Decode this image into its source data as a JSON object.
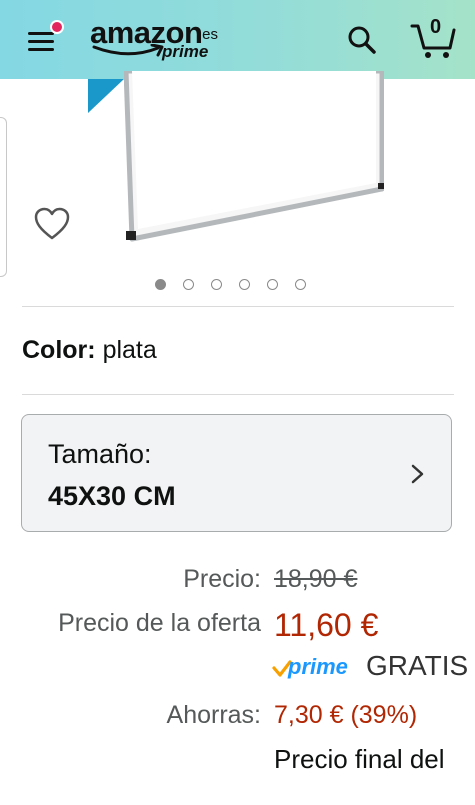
{
  "header": {
    "logo_word": "amazon",
    "logo_tld": ".es",
    "logo_sub": "prime",
    "cart_count": "0",
    "icons": [
      "menu-icon",
      "search-icon",
      "cart-icon"
    ],
    "notification_dot_color": "#e2275f"
  },
  "product": {
    "carousel_total": 6,
    "carousel_active": 1
  },
  "color": {
    "label": "Color:",
    "value": "plata"
  },
  "size": {
    "label": "Tamaño:",
    "value": "45X30 CM"
  },
  "price": {
    "list_label": "Precio:",
    "list_value": "18,90 €",
    "offer_label": "Precio de la oferta",
    "offer_value": "11,60 €",
    "prime_text": "prime",
    "shipping": "GRATIS",
    "savings_label": "Ahorras:",
    "savings_value": "7,30 € (39%)",
    "final_text": "Precio final del"
  },
  "colors": {
    "price_red": "#b12704",
    "prime_blue": "#1a98ff",
    "prime_check": "#f7a000"
  }
}
